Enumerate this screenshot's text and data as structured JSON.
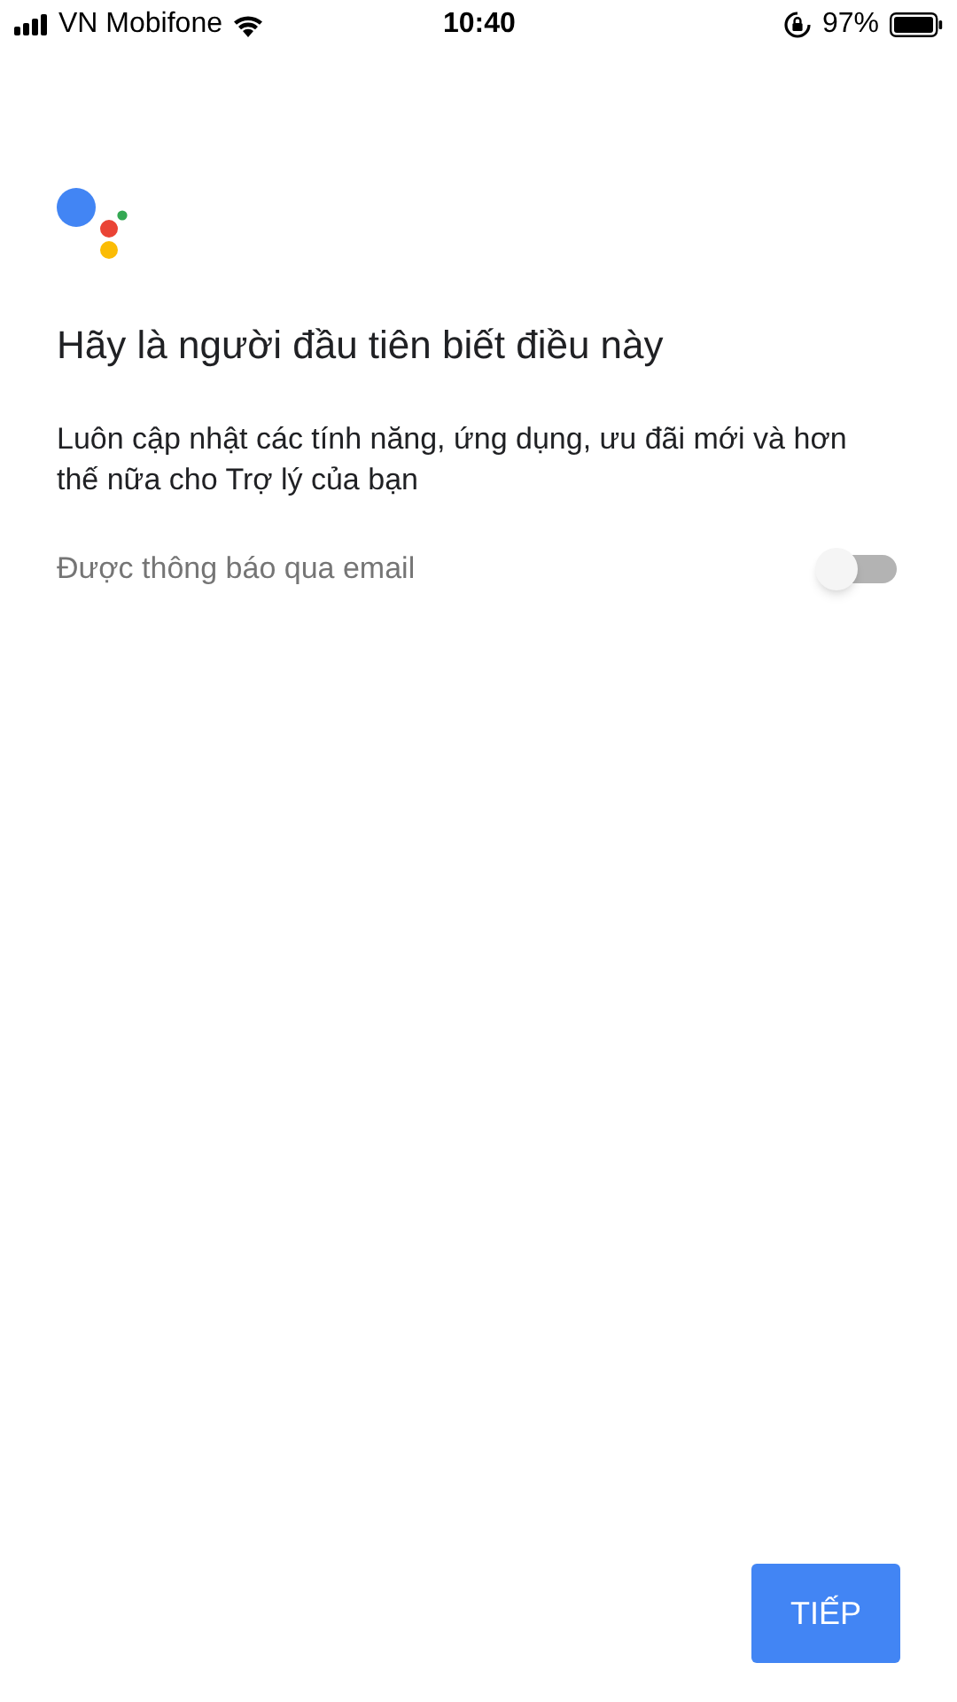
{
  "status_bar": {
    "carrier": "VN Mobifone",
    "time": "10:40",
    "battery": "97%"
  },
  "title": "Hãy là người đầu tiên biết điều này",
  "description": "Luôn cập nhật các tính năng, ứng dụng, ưu đãi mới và hơn thế nữa cho Trợ lý của bạn",
  "email_toggle": {
    "label": "Được thông báo qua email",
    "on": false
  },
  "next_button": "TIẾP"
}
